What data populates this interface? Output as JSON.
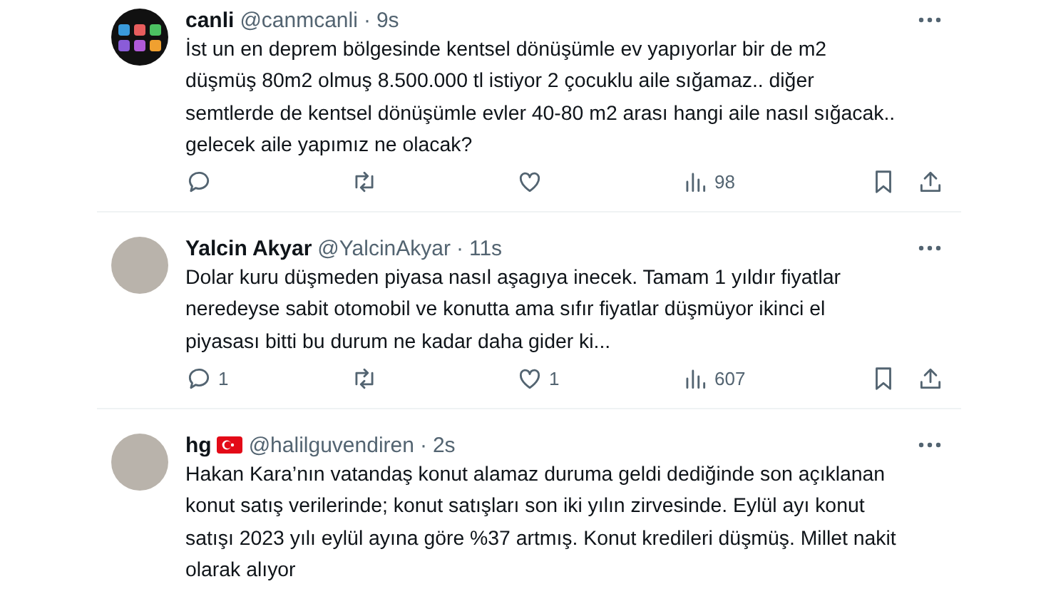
{
  "tweets": [
    {
      "avatar": {
        "kind": "app-grid"
      },
      "name": "canli",
      "has_flag": false,
      "handle": "@canmcanli",
      "separator": "·",
      "time": "9s",
      "text": "İst un en deprem bölgesinde kentsel dönüşümle ev yapıyorlar bir de m2 düşmüş 80m2 olmuş 8.500.000 tl istiyor  2 çocuklu aile sığamaz.. diğer semtlerde de kentsel dönüşümle evler 40-80 m2 arası hangi aile nasıl sığacak.. gelecek aile yapımız ne olacak?",
      "actions": [
        {
          "kind": "reply"
        },
        {
          "kind": "repost"
        },
        {
          "kind": "like"
        },
        {
          "kind": "views",
          "count": "98"
        },
        {
          "kind": "bookmark"
        },
        {
          "kind": "share"
        }
      ]
    },
    {
      "avatar": {
        "kind": "photo"
      },
      "name": "Yalcin Akyar",
      "has_flag": false,
      "handle": "@YalcinAkyar",
      "separator": "·",
      "time": "11s",
      "text": "Dolar kuru düşmeden piyasa nasıl aşagıya inecek. Tamam 1 yıldır fiyatlar neredeyse sabit otomobil ve konutta ama sıfır fiyatlar düşmüyor ikinci el piyasası bitti bu durum ne kadar daha gider ki...",
      "actions": [
        {
          "kind": "reply",
          "count": "1"
        },
        {
          "kind": "repost"
        },
        {
          "kind": "like",
          "count": "1"
        },
        {
          "kind": "views",
          "count": "607"
        },
        {
          "kind": "bookmark"
        },
        {
          "kind": "share"
        }
      ]
    },
    {
      "avatar": {
        "kind": "photo"
      },
      "name": "hg",
      "has_flag": true,
      "handle": "@halilguvendiren",
      "separator": "·",
      "time": "2s",
      "text": "Hakan Kara’nın vatandaş konut alamaz duruma geldi dediğinde son açıklanan konut satış verilerinde; konut satışları son iki yılın zirvesinde. Eylül ayı konut satışı 2023 yılı eylül ayına göre %37 artmış. Konut kredileri düşmüş. Millet nakit olarak alıyor"
    }
  ]
}
